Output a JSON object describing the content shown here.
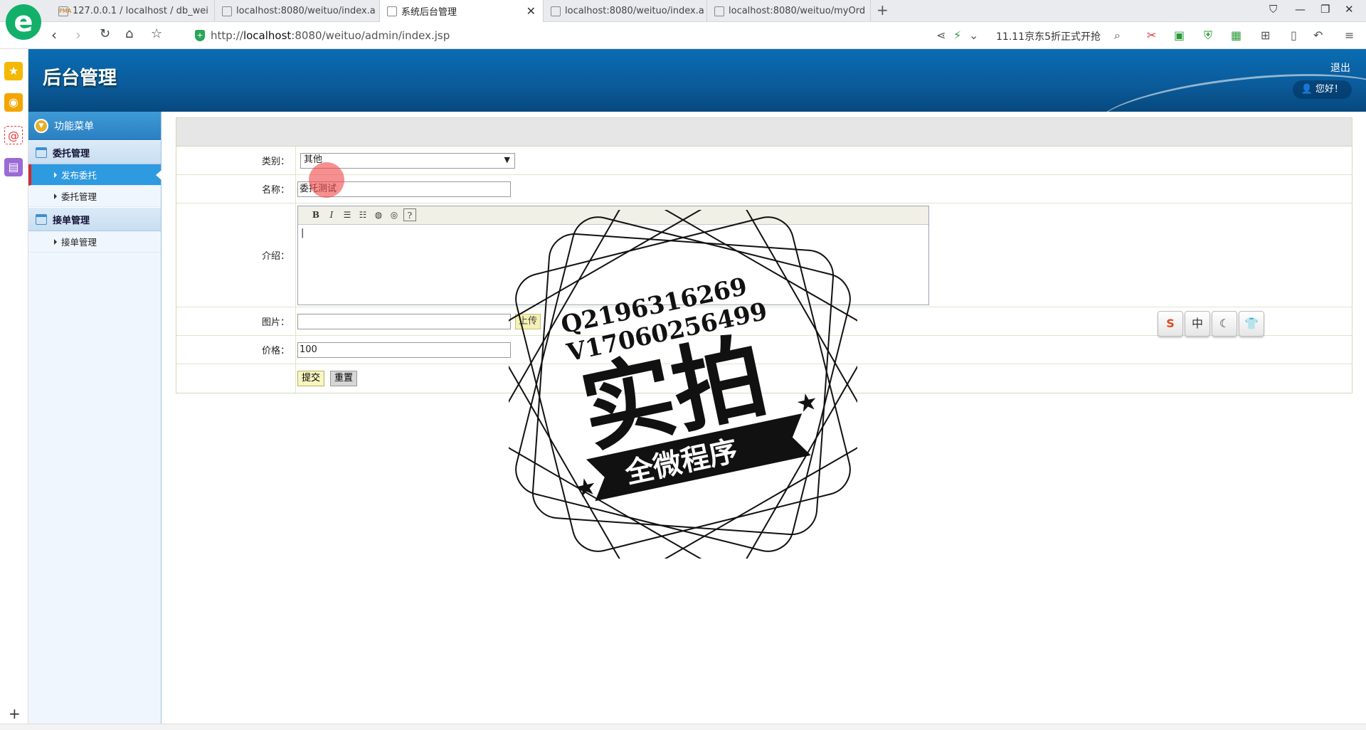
{
  "browser": {
    "tabs": [
      {
        "label": "127.0.0.1 / localhost / db_wei",
        "favicon": "PMA"
      },
      {
        "label": "localhost:8080/weituo/index.a"
      },
      {
        "label": "系统后台管理"
      },
      {
        "label": "localhost:8080/weituo/index.a"
      },
      {
        "label": "localhost:8080/weituo/myOrd"
      }
    ],
    "address_prefix": "http://",
    "address_host": "localhost",
    "address_rest": ":8080/weituo/admin/index.jsp",
    "promo": "11.11京东5折正式开抢",
    "logo_letter": "e"
  },
  "header": {
    "title": "后台管理",
    "logout": "退出",
    "greeting": "您好！"
  },
  "sidebar": {
    "menu_title": "功能菜单",
    "groups": [
      {
        "label": "委托管理",
        "items": [
          "发布委托",
          "委托管理"
        ]
      },
      {
        "label": "接单管理",
        "items": [
          "接单管理"
        ]
      }
    ]
  },
  "form": {
    "category_label": "类别：",
    "category_value": "其他",
    "name_label": "名称：",
    "name_value": "委托测试",
    "intro_label": "介绍：",
    "image_label": "图片：",
    "upload_label": "上传",
    "price_label": "价格：",
    "price_value": "100",
    "submit_label": "提交",
    "reset_label": "重置"
  },
  "editor_toolbar": {
    "bold": "B",
    "italic": "I",
    "ordered_list": "☰",
    "unordered_list": "☷",
    "link": "◍",
    "unlink": "◎",
    "help": "?"
  },
  "ime": {
    "chinese": "中"
  },
  "watermark": {
    "line1": "Q2196316269",
    "line2": "V17060256499",
    "big": "实拍",
    "banner": "全微程序"
  },
  "colors": {
    "accent": "#2e9ae0",
    "header": "#0b5a99"
  }
}
